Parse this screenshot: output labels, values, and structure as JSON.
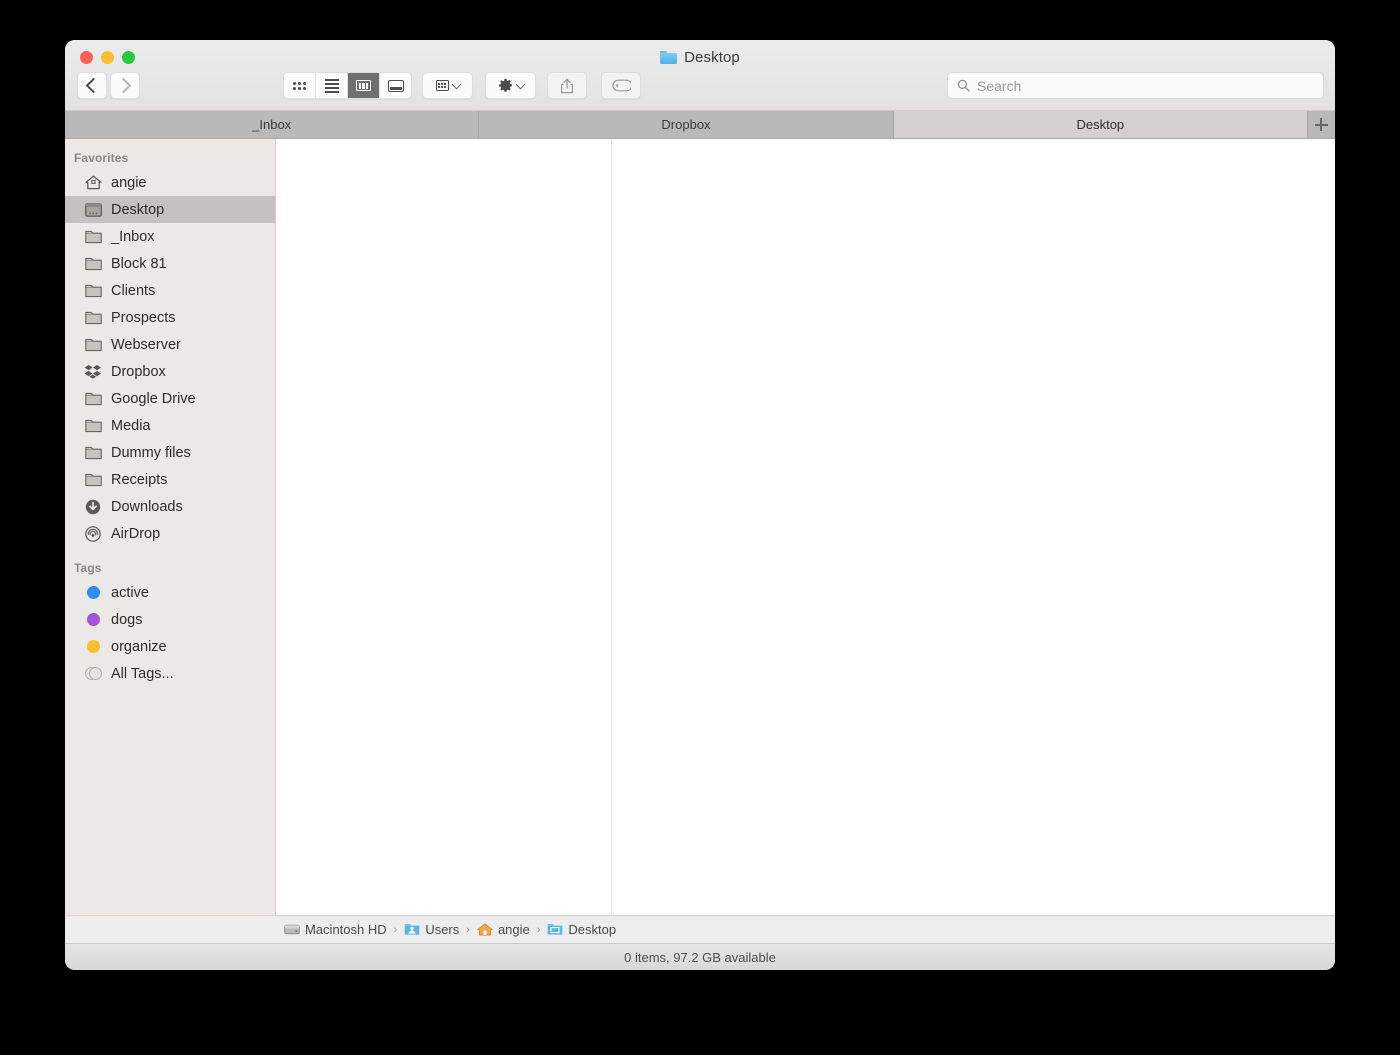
{
  "window": {
    "title": "Desktop",
    "title_icon": "folder-icon",
    "traffic_lights": [
      {
        "name": "close",
        "color": "#ff5f57"
      },
      {
        "name": "minimize",
        "color": "#febc2e"
      },
      {
        "name": "maximize",
        "color": "#28c840"
      }
    ]
  },
  "toolbar": {
    "back": {
      "icon": "chevron-left-icon",
      "enabled": true
    },
    "forward": {
      "icon": "chevron-right-icon",
      "enabled": false
    },
    "view_modes": [
      {
        "id": "icon",
        "icon": "icon-view-icon",
        "active": false
      },
      {
        "id": "list",
        "icon": "list-view-icon",
        "active": false
      },
      {
        "id": "column",
        "icon": "column-view-icon",
        "active": true
      },
      {
        "id": "gallery",
        "icon": "gallery-view-icon",
        "active": false
      }
    ],
    "arrange": {
      "icon": "arrange-icon",
      "chevron": "chevron-down-icon"
    },
    "action": {
      "icon": "gear-icon",
      "chevron": "chevron-down-icon"
    },
    "share": {
      "icon": "share-icon"
    },
    "tags": {
      "icon": "tag-icon"
    }
  },
  "search": {
    "icon": "search-icon",
    "placeholder": "Search",
    "value": ""
  },
  "tabs": {
    "items": [
      {
        "label": "_Inbox",
        "active": false
      },
      {
        "label": "Dropbox",
        "active": false
      },
      {
        "label": "Desktop",
        "active": true
      }
    ],
    "add_label": "+",
    "add_icon": "plus-icon"
  },
  "sidebar": {
    "sections": [
      {
        "header": "Favorites",
        "items": [
          {
            "label": "angie",
            "icon": "home-icon",
            "selected": false
          },
          {
            "label": "Desktop",
            "icon": "desktop-icon",
            "selected": true
          },
          {
            "label": "_Inbox",
            "icon": "folder-icon",
            "selected": false
          },
          {
            "label": "Block 81",
            "icon": "folder-icon",
            "selected": false
          },
          {
            "label": "Clients",
            "icon": "folder-icon",
            "selected": false
          },
          {
            "label": "Prospects",
            "icon": "folder-icon",
            "selected": false
          },
          {
            "label": "Webserver",
            "icon": "folder-icon",
            "selected": false
          },
          {
            "label": "Dropbox",
            "icon": "dropbox-icon",
            "selected": false
          },
          {
            "label": "Google Drive",
            "icon": "folder-icon",
            "selected": false
          },
          {
            "label": "Media",
            "icon": "folder-icon",
            "selected": false
          },
          {
            "label": "Dummy files",
            "icon": "folder-icon",
            "selected": false
          },
          {
            "label": "Receipts",
            "icon": "folder-icon",
            "selected": false
          },
          {
            "label": "Downloads",
            "icon": "downloads-icon",
            "selected": false
          },
          {
            "label": "AirDrop",
            "icon": "airdrop-icon",
            "selected": false
          }
        ]
      },
      {
        "header": "Tags",
        "items": [
          {
            "label": "active",
            "icon": "tag-dot-icon",
            "color": "#2e8ef0"
          },
          {
            "label": "dogs",
            "icon": "tag-dot-icon",
            "color": "#a554d8"
          },
          {
            "label": "organize",
            "icon": "tag-dot-icon",
            "color": "#f6c026"
          },
          {
            "label": "All Tags...",
            "icon": "all-tags-icon",
            "color": "#e6e2df"
          }
        ]
      }
    ]
  },
  "pathbar": {
    "crumbs": [
      {
        "label": "Macintosh HD",
        "icon": "harddisk-icon"
      },
      {
        "label": "Users",
        "icon": "users-folder-icon"
      },
      {
        "label": "angie",
        "icon": "home-icon"
      },
      {
        "label": "Desktop",
        "icon": "desktop-folder-icon"
      }
    ],
    "separator": "›"
  },
  "statusbar": {
    "text": "0 items, 97.2 GB available"
  },
  "content": {
    "columns": [
      {
        "items": []
      },
      {
        "items": []
      }
    ]
  }
}
